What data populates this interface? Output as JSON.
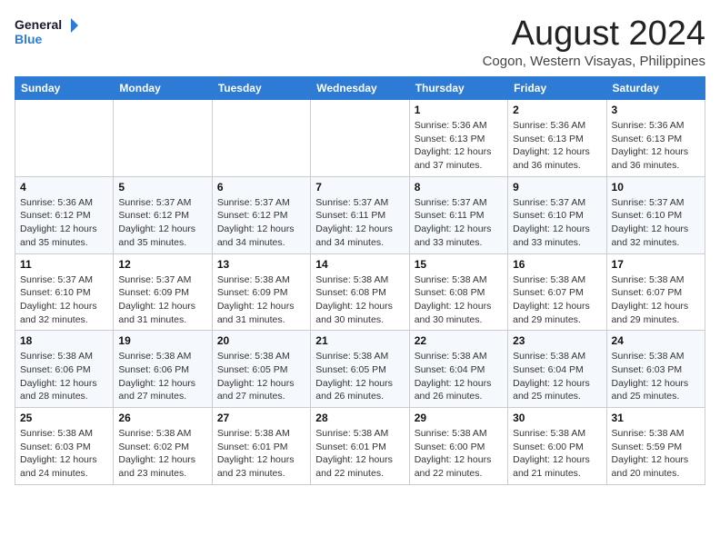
{
  "logo": {
    "line1": "General",
    "line2": "Blue"
  },
  "title": "August 2024",
  "subtitle": "Cogon, Western Visayas, Philippines",
  "weekdays": [
    "Sunday",
    "Monday",
    "Tuesday",
    "Wednesday",
    "Thursday",
    "Friday",
    "Saturday"
  ],
  "weeks": [
    [
      {
        "day": "",
        "info": ""
      },
      {
        "day": "",
        "info": ""
      },
      {
        "day": "",
        "info": ""
      },
      {
        "day": "",
        "info": ""
      },
      {
        "day": "1",
        "info": "Sunrise: 5:36 AM\nSunset: 6:13 PM\nDaylight: 12 hours\nand 37 minutes."
      },
      {
        "day": "2",
        "info": "Sunrise: 5:36 AM\nSunset: 6:13 PM\nDaylight: 12 hours\nand 36 minutes."
      },
      {
        "day": "3",
        "info": "Sunrise: 5:36 AM\nSunset: 6:13 PM\nDaylight: 12 hours\nand 36 minutes."
      }
    ],
    [
      {
        "day": "4",
        "info": "Sunrise: 5:36 AM\nSunset: 6:12 PM\nDaylight: 12 hours\nand 35 minutes."
      },
      {
        "day": "5",
        "info": "Sunrise: 5:37 AM\nSunset: 6:12 PM\nDaylight: 12 hours\nand 35 minutes."
      },
      {
        "day": "6",
        "info": "Sunrise: 5:37 AM\nSunset: 6:12 PM\nDaylight: 12 hours\nand 34 minutes."
      },
      {
        "day": "7",
        "info": "Sunrise: 5:37 AM\nSunset: 6:11 PM\nDaylight: 12 hours\nand 34 minutes."
      },
      {
        "day": "8",
        "info": "Sunrise: 5:37 AM\nSunset: 6:11 PM\nDaylight: 12 hours\nand 33 minutes."
      },
      {
        "day": "9",
        "info": "Sunrise: 5:37 AM\nSunset: 6:10 PM\nDaylight: 12 hours\nand 33 minutes."
      },
      {
        "day": "10",
        "info": "Sunrise: 5:37 AM\nSunset: 6:10 PM\nDaylight: 12 hours\nand 32 minutes."
      }
    ],
    [
      {
        "day": "11",
        "info": "Sunrise: 5:37 AM\nSunset: 6:10 PM\nDaylight: 12 hours\nand 32 minutes."
      },
      {
        "day": "12",
        "info": "Sunrise: 5:37 AM\nSunset: 6:09 PM\nDaylight: 12 hours\nand 31 minutes."
      },
      {
        "day": "13",
        "info": "Sunrise: 5:38 AM\nSunset: 6:09 PM\nDaylight: 12 hours\nand 31 minutes."
      },
      {
        "day": "14",
        "info": "Sunrise: 5:38 AM\nSunset: 6:08 PM\nDaylight: 12 hours\nand 30 minutes."
      },
      {
        "day": "15",
        "info": "Sunrise: 5:38 AM\nSunset: 6:08 PM\nDaylight: 12 hours\nand 30 minutes."
      },
      {
        "day": "16",
        "info": "Sunrise: 5:38 AM\nSunset: 6:07 PM\nDaylight: 12 hours\nand 29 minutes."
      },
      {
        "day": "17",
        "info": "Sunrise: 5:38 AM\nSunset: 6:07 PM\nDaylight: 12 hours\nand 29 minutes."
      }
    ],
    [
      {
        "day": "18",
        "info": "Sunrise: 5:38 AM\nSunset: 6:06 PM\nDaylight: 12 hours\nand 28 minutes."
      },
      {
        "day": "19",
        "info": "Sunrise: 5:38 AM\nSunset: 6:06 PM\nDaylight: 12 hours\nand 27 minutes."
      },
      {
        "day": "20",
        "info": "Sunrise: 5:38 AM\nSunset: 6:05 PM\nDaylight: 12 hours\nand 27 minutes."
      },
      {
        "day": "21",
        "info": "Sunrise: 5:38 AM\nSunset: 6:05 PM\nDaylight: 12 hours\nand 26 minutes."
      },
      {
        "day": "22",
        "info": "Sunrise: 5:38 AM\nSunset: 6:04 PM\nDaylight: 12 hours\nand 26 minutes."
      },
      {
        "day": "23",
        "info": "Sunrise: 5:38 AM\nSunset: 6:04 PM\nDaylight: 12 hours\nand 25 minutes."
      },
      {
        "day": "24",
        "info": "Sunrise: 5:38 AM\nSunset: 6:03 PM\nDaylight: 12 hours\nand 25 minutes."
      }
    ],
    [
      {
        "day": "25",
        "info": "Sunrise: 5:38 AM\nSunset: 6:03 PM\nDaylight: 12 hours\nand 24 minutes."
      },
      {
        "day": "26",
        "info": "Sunrise: 5:38 AM\nSunset: 6:02 PM\nDaylight: 12 hours\nand 23 minutes."
      },
      {
        "day": "27",
        "info": "Sunrise: 5:38 AM\nSunset: 6:01 PM\nDaylight: 12 hours\nand 23 minutes."
      },
      {
        "day": "28",
        "info": "Sunrise: 5:38 AM\nSunset: 6:01 PM\nDaylight: 12 hours\nand 22 minutes."
      },
      {
        "day": "29",
        "info": "Sunrise: 5:38 AM\nSunset: 6:00 PM\nDaylight: 12 hours\nand 22 minutes."
      },
      {
        "day": "30",
        "info": "Sunrise: 5:38 AM\nSunset: 6:00 PM\nDaylight: 12 hours\nand 21 minutes."
      },
      {
        "day": "31",
        "info": "Sunrise: 5:38 AM\nSunset: 5:59 PM\nDaylight: 12 hours\nand 20 minutes."
      }
    ]
  ]
}
